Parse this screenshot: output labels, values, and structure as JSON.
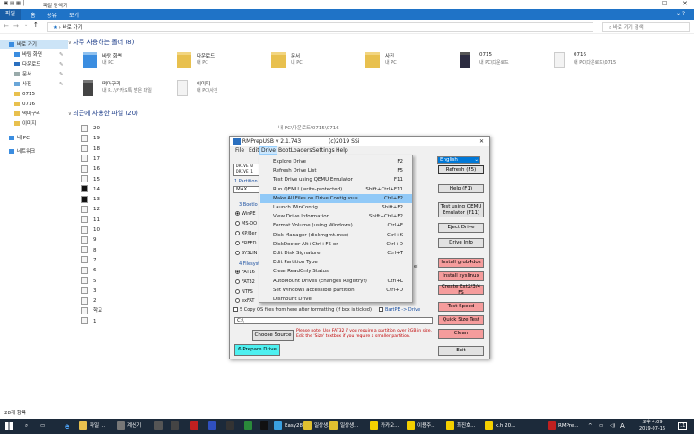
{
  "explorer": {
    "title": "파일 탐색기",
    "ribbon_tabs": [
      "파일",
      "홈",
      "공유",
      "보기"
    ],
    "address": "바로 가기",
    "search_placeholder": "바로 가기 검색",
    "nav": [
      {
        "label": "바로 가기",
        "selected": true
      },
      {
        "label": "바탕 화면"
      },
      {
        "label": "다운로드"
      },
      {
        "label": "문서"
      },
      {
        "label": "사진"
      },
      {
        "label": "0715"
      },
      {
        "label": "0716"
      },
      {
        "label": "떡마구리"
      },
      {
        "label": "이미지"
      },
      {
        "label": "내 PC"
      },
      {
        "label": "네트워크"
      }
    ],
    "frequent_header": "자주 사용하는 폴더 (8)",
    "frequent": [
      {
        "name": "바탕 화면",
        "sub": "내 PC"
      },
      {
        "name": "다운로드",
        "sub": "내 PC"
      },
      {
        "name": "문서",
        "sub": "내 PC"
      },
      {
        "name": "사진",
        "sub": "내 PC"
      },
      {
        "name": "0715",
        "sub": "내 PC\\다운로드"
      },
      {
        "name": "0716",
        "sub": "내 PC\\다운로드\\0715"
      },
      {
        "name": "떡마구리",
        "sub": "내 P...\\카카오톡 받은 파일"
      },
      {
        "name": "이미지",
        "sub": "내 PC\\사진"
      }
    ],
    "recent_header": "최근에 사용한 파일 (20)",
    "recent": [
      "20",
      "19",
      "18",
      "17",
      "16",
      "15",
      "14",
      "13",
      "12",
      "11",
      "10",
      "9",
      "8",
      "7",
      "6",
      "5",
      "3",
      "2",
      "학교",
      "1"
    ],
    "recent_path": "내 PC\\다운로드\\0715\\0716",
    "status": "28개 항목"
  },
  "dialog": {
    "title": "RMPrepUSB v 2.1.743",
    "copyright": "(c)2019 SSi",
    "menu": [
      "File",
      "Edit",
      "Drive",
      "BootLoaders",
      "Settings",
      "Help"
    ],
    "language": "English",
    "drive_list": [
      "DRIVE 0",
      "DRIVE 1"
    ],
    "partition_label": "1 Partition S",
    "size_value": "MAX",
    "bootloader_label": "3 Bootlo",
    "bootloaders": [
      "WinPE",
      "MS-DO",
      "XP/Ber",
      "FREED",
      "SYSLIN"
    ],
    "filesystem_label": "4 Filesyst",
    "filesystems": [
      "FAT16",
      "FAT32",
      "NTFS",
      "exFAT"
    ],
    "copy_label": "5 Copy OS files from here after formatting (if box is ticked)",
    "bartpe_label": "BartPE -> Drive",
    "source_path": "C:\\",
    "choose_source": "Choose Source",
    "note": "Please note: Use FAT32 if you require a partition over 2GB in size. Edit the 'Size' textbox if you require a smaller partition.",
    "prepare_drive": "6 Prepare Drive",
    "buttons": {
      "refresh": "Refresh (F5)",
      "help": "Help (F1)",
      "test_qemu": "Test using QEMU Emulator (F11)",
      "eject": "Eject Drive",
      "drive_info": "Drive Info",
      "install_grub4dos": "Install grub4dos",
      "install_syslinux": "Install syslinux",
      "create_ext": "Create Ext2/3/4 FS",
      "test_speed": "Test Speed",
      "quick_size": "Quick Size Test",
      "clean": "Clean",
      "exit": "Exit"
    }
  },
  "drive_menu": [
    {
      "label": "Explore Drive",
      "shortcut": "F2"
    },
    {
      "label": "Refresh Drive List",
      "shortcut": "F5"
    },
    {
      "label": "Test Drive using QEMU Emulator",
      "shortcut": "F11"
    },
    {
      "label": "Run QEMU (write-protected)",
      "shortcut": "Shift+Ctrl+F11"
    },
    {
      "label": "Make All Files on Drive Contiguous",
      "shortcut": "Ctrl+F2",
      "highlighted": true
    },
    {
      "label": "Launch WinContig",
      "shortcut": "Shift+F2"
    },
    {
      "label": "View Drive Information",
      "shortcut": "Shift+Ctrl+F2"
    },
    {
      "label": "Format Volume (using Windows)",
      "shortcut": "Ctrl+F"
    },
    {
      "label": "Disk Manager (diskmgmt.msc)",
      "shortcut": "Ctrl+K"
    },
    {
      "label": "DiskDoctor      Alt+Ctrl+F5 or",
      "shortcut": "Ctrl+D"
    },
    {
      "label": "Edit Disk Signature",
      "shortcut": "Ctrl+T"
    },
    {
      "label": "Edit Partition Type",
      "shortcut": ""
    },
    {
      "label": "Clear ReadOnly Status",
      "shortcut": ""
    },
    {
      "label": "AutoMount Drives (changes Registry!)",
      "shortcut": "Ctrl+L"
    },
    {
      "label": "Set Windows accessible partition",
      "shortcut": "Ctrl+O"
    },
    {
      "label": "Dismount Drive",
      "shortcut": ""
    }
  ],
  "taskbar": {
    "items": [
      "파일 ...",
      "계산기",
      "Easy28...",
      "일상생...",
      "일상생...",
      "카카오...",
      "이용주...",
      "최진호...",
      "k.h 20...",
      "RMPre..."
    ],
    "lang": "A",
    "time": "오후 4:09",
    "date": "2019-07-16",
    "notif": "11"
  },
  "colors": {
    "accent": "#1f73c7",
    "highlight": "#91c9f7",
    "red_button": "#f59c9c",
    "cyan_button": "#4ef0f0"
  }
}
